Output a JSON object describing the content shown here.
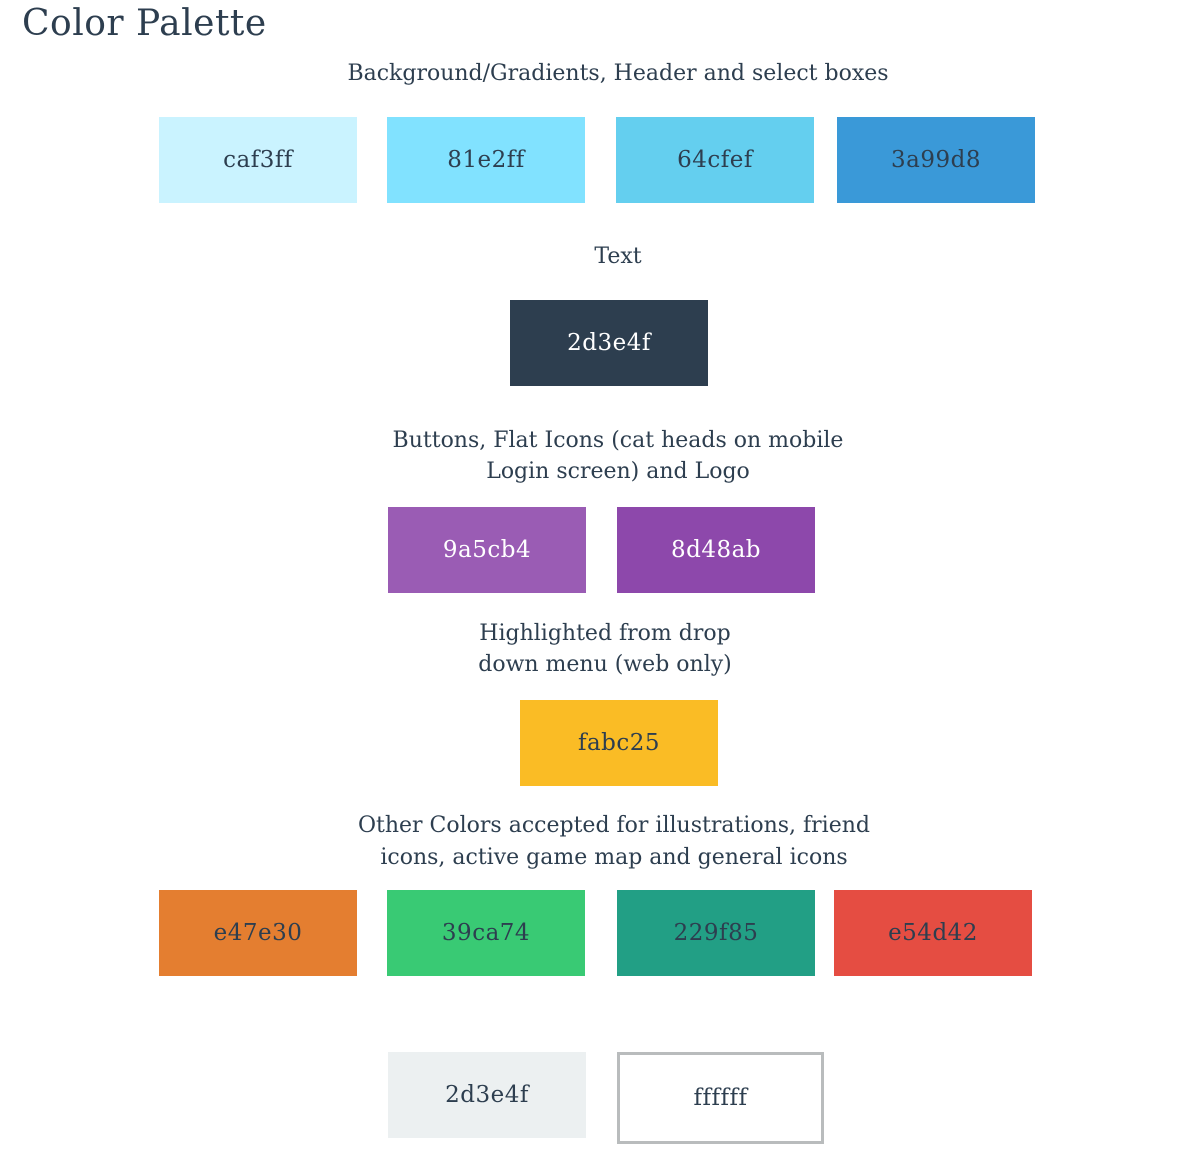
{
  "title": "Color Palette",
  "sections": [
    {
      "label_lines": [
        "Background/Gradients, Header and select boxes"
      ],
      "swatches": [
        {
          "label": "caf3ff",
          "color": "#caf3ff"
        },
        {
          "label": "81e2ff",
          "color": "#81e2ff"
        },
        {
          "label": "64cfef",
          "color": "#64cfef"
        },
        {
          "label": "3a99d8",
          "color": "#3a99d8"
        }
      ]
    },
    {
      "label_lines": [
        "Text"
      ],
      "swatches": [
        {
          "label": "2d3e4f",
          "color": "#2d3e4f"
        }
      ]
    },
    {
      "label_lines": [
        "Buttons, Flat Icons (cat heads on mobile",
        "Login screen) and Logo"
      ],
      "swatches": [
        {
          "label": "9a5cb4",
          "color": "#9a5cb4"
        },
        {
          "label": "8d48ab",
          "color": "#8d48ab"
        }
      ]
    },
    {
      "label_lines": [
        "Highlighted from drop",
        "down menu (web only)"
      ],
      "swatches": [
        {
          "label": "fabc25",
          "color": "#fabc25"
        }
      ]
    },
    {
      "label_lines": [
        "Other Colors accepted for illustrations, friend",
        "icons, active game map and general icons"
      ],
      "swatches": [
        {
          "label": "e47e30",
          "color": "#e47e30"
        },
        {
          "label": "39ca74",
          "color": "#39ca74"
        },
        {
          "label": "229f85",
          "color": "#229f85"
        },
        {
          "label": "e54d42",
          "color": "#e54d42"
        }
      ]
    },
    {
      "label_lines": [],
      "swatches": [
        {
          "label": "2d3e4f",
          "color": "#ecf0f1"
        },
        {
          "label": "ffffff",
          "color": "#ffffff"
        }
      ]
    }
  ]
}
